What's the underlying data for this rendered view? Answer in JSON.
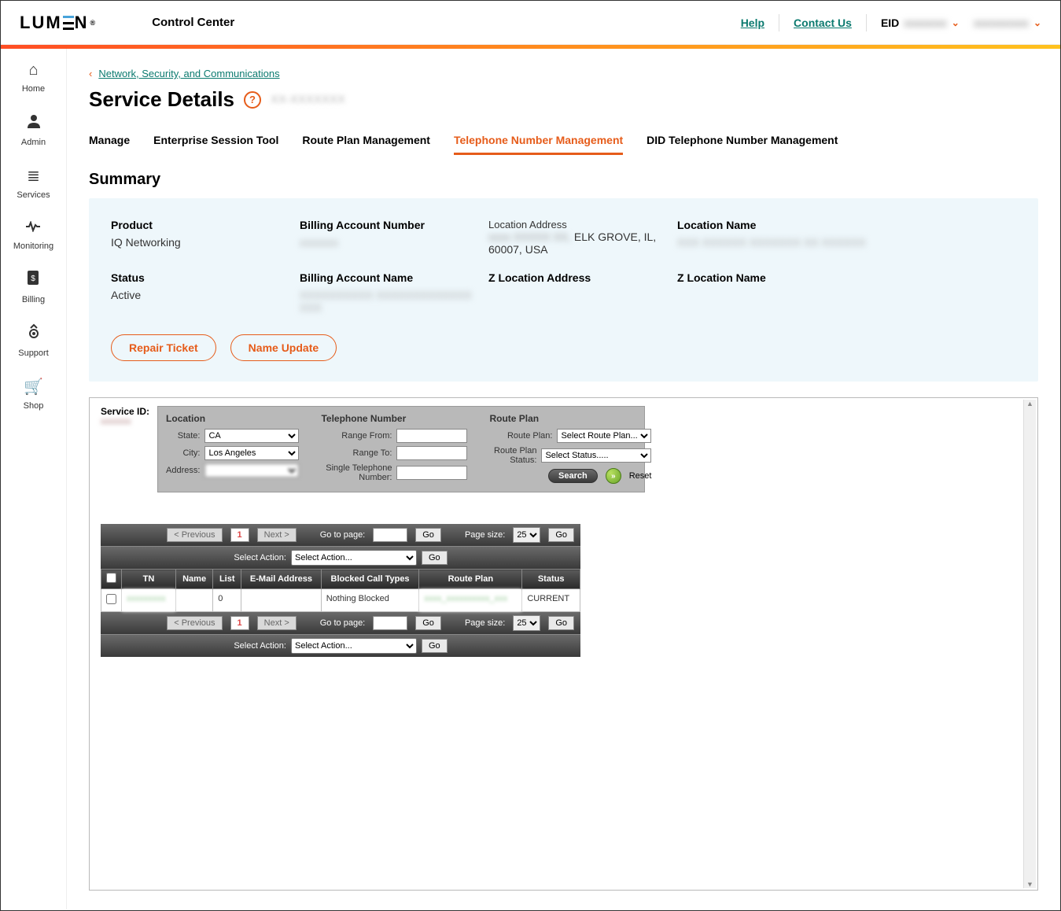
{
  "header": {
    "logo_text_before": "LUM",
    "logo_text_after": "N",
    "logo_sup": "®",
    "app_title": "Control Center",
    "help": "Help",
    "contact": "Contact Us",
    "eid_label": "EID",
    "eid_value": "xxxxxxx",
    "user_value": "xxxxxxxxx"
  },
  "sidebar": {
    "items": [
      {
        "icon": "⌂",
        "label": "Home"
      },
      {
        "icon": "●",
        "label": "Admin"
      },
      {
        "icon": "≣",
        "label": "Services"
      },
      {
        "icon": "〰",
        "label": "Monitoring"
      },
      {
        "icon": "▤",
        "label": "Billing"
      },
      {
        "icon": "⚙",
        "label": "Support"
      },
      {
        "icon": "🛒",
        "label": "Shop"
      }
    ]
  },
  "breadcrumb": {
    "text": "Network, Security, and Communications"
  },
  "page": {
    "title": "Service Details",
    "service_id": "XX-XXXXXXX"
  },
  "tabs": [
    {
      "label": "Manage"
    },
    {
      "label": "Enterprise Session Tool"
    },
    {
      "label": "Route Plan Management"
    },
    {
      "label": "Telephone Number Management",
      "active": true
    },
    {
      "label": "DID Telephone Number Management"
    }
  ],
  "summary": {
    "heading": "Summary",
    "fields": {
      "product_label": "Product",
      "product_value": "IQ Networking",
      "ban_label": "Billing Account Number",
      "ban_value": "xxxxxxx",
      "loc_addr_label": "Location Address",
      "loc_addr_value_blur": "xxxx XXXXX XX,",
      "loc_addr_value_clear": " ELK GROVE, IL, 60007, USA",
      "loc_name_label": "Location Name",
      "loc_name_value": "XXX XXXXXX XXXXXXX XX XXXXXX",
      "status_label": "Status",
      "status_value": "Active",
      "ban_name_label": "Billing Account Name",
      "ban_name_value": "XXXXXXXXXX XXXXXXXXXXXXX XXX",
      "z_loc_addr_label": "Z Location Address",
      "z_loc_name_label": "Z Location Name"
    },
    "actions": {
      "repair": "Repair Ticket",
      "name_update": "Name Update"
    }
  },
  "inner": {
    "service_id_label": "Service ID:",
    "service_id_value": "xxxxxxx",
    "filters": {
      "location_heading": "Location",
      "state_label": "State:",
      "state_value": "CA",
      "city_label": "City:",
      "city_value": "Los Angeles",
      "address_label": "Address:",
      "address_value": "",
      "tn_heading": "Telephone Number",
      "range_from_label": "Range From:",
      "range_to_label": "Range To:",
      "single_tn_label": "Single Telephone Number:",
      "rp_heading": "Route Plan",
      "rp_label": "Route Plan:",
      "rp_value": "Select Route Plan.....",
      "rp_status_label": "Route Plan Status:",
      "rp_status_value": "Select Status.....",
      "search": "Search",
      "reset": "Reset"
    },
    "pager": {
      "prev": "< Previous",
      "page": "1",
      "next": "Next >",
      "goto_label": "Go to page:",
      "go": "Go",
      "page_size_label": "Page size:",
      "page_size_value": "25"
    },
    "action_bar": {
      "label": "Select Action:",
      "value": "Select Action...",
      "go": "Go"
    },
    "table": {
      "headers": [
        "",
        "TN",
        "Name",
        "List",
        "E-Mail Address",
        "Blocked Call Types",
        "Route Plan",
        "Status"
      ],
      "row": {
        "tn": "xxxxxxxxx",
        "name": "",
        "list": "0",
        "email": "",
        "blocked": "Nothing Blocked",
        "route_plan": "xxxx_xxxxxxxxxx_xxx",
        "status": "CURRENT"
      }
    }
  }
}
